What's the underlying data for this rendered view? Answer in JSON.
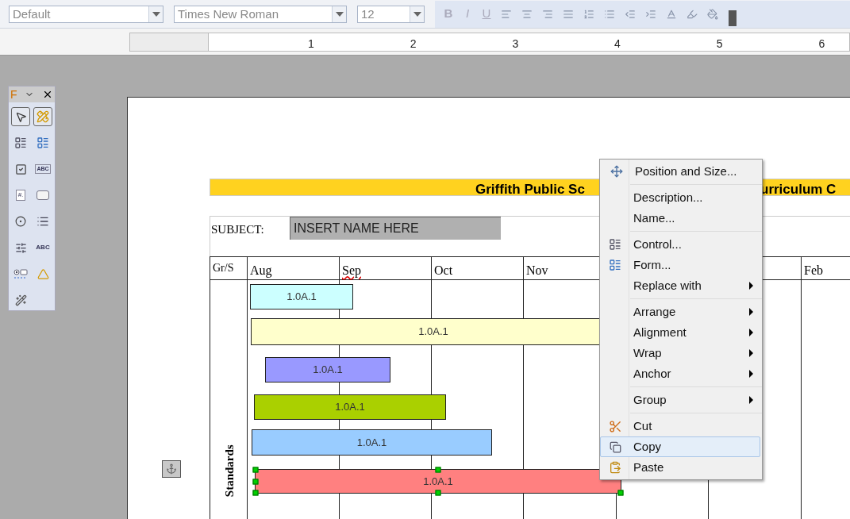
{
  "toolbar": {
    "style": "Default",
    "font": "Times New Roman",
    "size": "12",
    "format_buttons": [
      {
        "kind": "text",
        "label": "B"
      },
      {
        "kind": "text",
        "label": "I"
      },
      {
        "kind": "text",
        "label": "U"
      },
      {
        "kind": "icon"
      },
      {
        "kind": "icon"
      },
      {
        "kind": "icon"
      },
      {
        "kind": "icon"
      },
      {
        "kind": "icon"
      },
      {
        "kind": "icon"
      },
      {
        "kind": "icon"
      },
      {
        "kind": "icon"
      },
      {
        "kind": "icon"
      },
      {
        "kind": "icon"
      },
      {
        "kind": "icon"
      }
    ]
  },
  "ruler": {
    "labels": [
      "1",
      "2",
      "3",
      "4",
      "5",
      "6"
    ]
  },
  "form_toolbar": {
    "title": "F",
    "tools": [
      {
        "kind": "icon",
        "selected": true
      },
      {
        "kind": "icon",
        "selected": true
      },
      {
        "kind": "icon",
        "selected": false
      },
      {
        "kind": "icon",
        "selected": false
      },
      {
        "kind": "icon",
        "selected": false
      },
      {
        "kind": "text",
        "label": "ABC",
        "selected": false
      },
      {
        "kind": "text",
        "label": "#.",
        "selected": false
      },
      {
        "kind": "icon",
        "selected": false
      },
      {
        "kind": "icon",
        "selected": false
      },
      {
        "kind": "icon",
        "selected": false
      },
      {
        "kind": "icon",
        "selected": false
      },
      {
        "kind": "text",
        "label": "ABC",
        "selected": false
      },
      {
        "kind": "icon",
        "selected": false
      },
      {
        "kind": "icon",
        "selected": false
      },
      {
        "kind": "icon",
        "selected": false
      }
    ]
  },
  "document": {
    "title_left": "Griffith Public Sc",
    "title_right": "urriculum C",
    "subject_label": "SUBJECT:",
    "subject_value": "INSERT NAME HERE",
    "columns": [
      "Gr/S",
      "Aug",
      "Sep",
      "Oct",
      "Nov",
      "",
      "",
      "Feb"
    ],
    "row_label": "Standards",
    "bars": [
      {
        "label": "1.0A.1",
        "color": "#ccffff",
        "selected": false
      },
      {
        "label": "1.0A.1",
        "color": "#ffffcc",
        "selected": false
      },
      {
        "label": "1.0A.1",
        "color": "#9999ff",
        "selected": false
      },
      {
        "label": "1.0A.1",
        "color": "#aad000",
        "selected": false
      },
      {
        "label": "1.0A.1",
        "color": "#99ccff",
        "selected": false
      },
      {
        "label": "1.0A.1",
        "color": "#ff8080",
        "selected": true
      }
    ]
  },
  "context_menu": {
    "groups": [
      [
        {
          "label": "Position and Size...",
          "submenu": false,
          "selected": false
        }
      ],
      [
        {
          "label": "Description...",
          "submenu": false,
          "selected": false
        },
        {
          "label": "Name...",
          "submenu": false,
          "selected": false
        }
      ],
      [
        {
          "label": "Control...",
          "submenu": false,
          "selected": false
        },
        {
          "label": "Form...",
          "submenu": false,
          "selected": false
        },
        {
          "label": "Replace with",
          "submenu": true,
          "selected": false
        }
      ],
      [
        {
          "label": "Arrange",
          "submenu": true,
          "selected": false
        },
        {
          "label": "Alignment",
          "submenu": true,
          "selected": false
        },
        {
          "label": "Wrap",
          "submenu": true,
          "selected": false
        },
        {
          "label": "Anchor",
          "submenu": true,
          "selected": false
        }
      ],
      [
        {
          "label": "Group",
          "submenu": true,
          "selected": false
        }
      ],
      [
        {
          "label": "Cut",
          "submenu": false,
          "selected": false
        },
        {
          "label": "Copy",
          "submenu": false,
          "selected": true
        },
        {
          "label": "Paste",
          "submenu": false,
          "selected": false
        }
      ]
    ]
  }
}
